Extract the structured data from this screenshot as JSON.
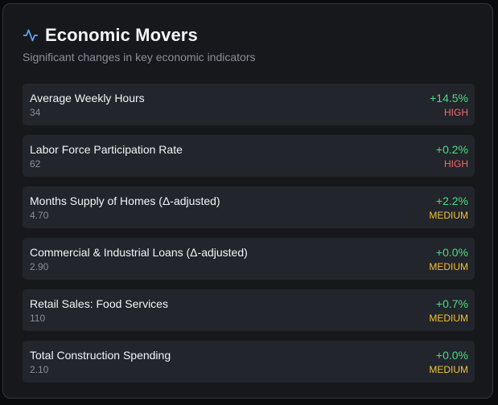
{
  "header": {
    "title": "Economic Movers",
    "subtitle": "Significant changes in key economic indicators",
    "icon": "activity-pulse-icon",
    "icon_color": "#60a5fa"
  },
  "colors": {
    "positive": "#4ade80",
    "high": "#f16b6b",
    "medium": "#f2c230"
  },
  "movers": [
    {
      "name": "Average Weekly Hours",
      "value": "34",
      "change": "+14.5%",
      "level": "HIGH"
    },
    {
      "name": "Labor Force Participation Rate",
      "value": "62",
      "change": "+0.2%",
      "level": "HIGH"
    },
    {
      "name": "Months Supply of Homes (Δ-adjusted)",
      "value": "4.70",
      "change": "+2.2%",
      "level": "MEDIUM"
    },
    {
      "name": "Commercial & Industrial Loans (Δ-adjusted)",
      "value": "2.90",
      "change": "+0.0%",
      "level": "MEDIUM"
    },
    {
      "name": "Retail Sales: Food Services",
      "value": "110",
      "change": "+0.7%",
      "level": "MEDIUM"
    },
    {
      "name": "Total Construction Spending",
      "value": "2.10",
      "change": "+0.0%",
      "level": "MEDIUM"
    }
  ]
}
